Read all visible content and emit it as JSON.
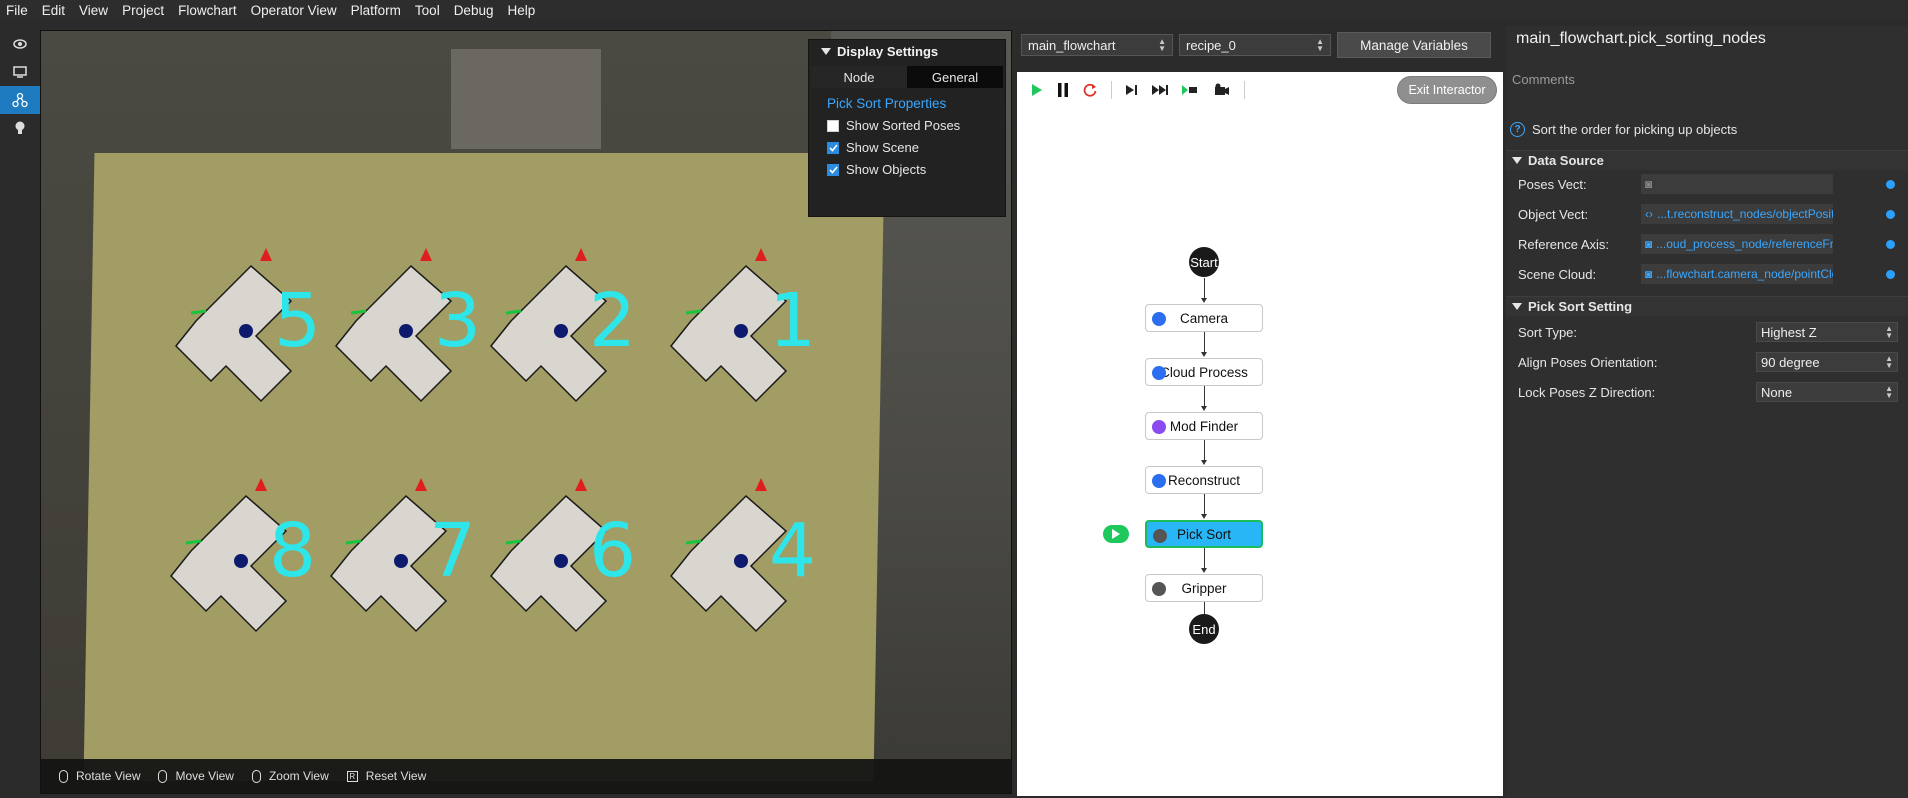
{
  "menu": [
    "File",
    "Edit",
    "View",
    "Project",
    "Flowchart",
    "Operator View",
    "Platform",
    "Tool",
    "Debug",
    "Help"
  ],
  "left_toolbar": [
    {
      "icon": "eye-camera-icon"
    },
    {
      "icon": "monitor-icon"
    },
    {
      "icon": "flowchart-icon",
      "active": true
    },
    {
      "icon": "lightbulb-icon"
    }
  ],
  "viewer": {
    "labels": [
      "5",
      "3",
      "2",
      "1",
      "8",
      "7",
      "6",
      "4"
    ],
    "footer": {
      "rotate": "Rotate View",
      "move": "Move View",
      "zoom": "Zoom View",
      "reset_key": "R",
      "reset": "Reset View"
    },
    "label_color": "#2ee6ea"
  },
  "display_settings": {
    "title": "Display Settings",
    "tabs": [
      "Node",
      "General"
    ],
    "active_tab": "General",
    "heading": "Pick Sort Properties",
    "options": [
      {
        "label": "Show Sorted Poses",
        "checked": false
      },
      {
        "label": "Show Scene",
        "checked": true
      },
      {
        "label": "Show Objects",
        "checked": true
      }
    ]
  },
  "flow_header": {
    "flowchart_select": "main_flowchart",
    "recipe_select": "recipe_0",
    "manage_variables": "Manage Variables",
    "exit_interactor": "Exit Interactor"
  },
  "flowchart": {
    "start": "Start",
    "end": "End",
    "nodes": [
      {
        "label": "Camera",
        "icon": "camera-icon",
        "active": false
      },
      {
        "label": "Cloud Process",
        "icon": "cloud-process-icon",
        "active": false
      },
      {
        "label": "Mod Finder",
        "icon": "mod-finder-icon",
        "active": false
      },
      {
        "label": "Reconstruct",
        "icon": "reconstruct-icon",
        "active": false
      },
      {
        "label": "Pick Sort",
        "icon": "pick-sort-icon",
        "active": true
      },
      {
        "label": "Gripper",
        "icon": "gripper-icon",
        "active": false
      }
    ]
  },
  "properties": {
    "title": "main_flowchart.pick_sorting_nodes",
    "comments": "Comments",
    "description": "Sort the order for picking up objects",
    "data_source": {
      "heading": "Data Source",
      "rows": [
        {
          "label": "Poses Vect:",
          "value": ""
        },
        {
          "label": "Object Vect:",
          "value": "...t.reconstruct_nodes/objectPositions"
        },
        {
          "label": "Reference Axis:",
          "value": "...oud_process_node/referenceFrame"
        },
        {
          "label": "Scene Cloud:",
          "value": "...flowchart.camera_node/pointCloud"
        }
      ]
    },
    "pick_sort_setting": {
      "heading": "Pick Sort Setting",
      "rows": [
        {
          "label": "Sort Type:",
          "value": "Highest Z"
        },
        {
          "label": "Align Poses Orientation:",
          "value": "90 degree"
        },
        {
          "label": "Lock Poses Z Direction:",
          "value": "None"
        }
      ]
    }
  }
}
